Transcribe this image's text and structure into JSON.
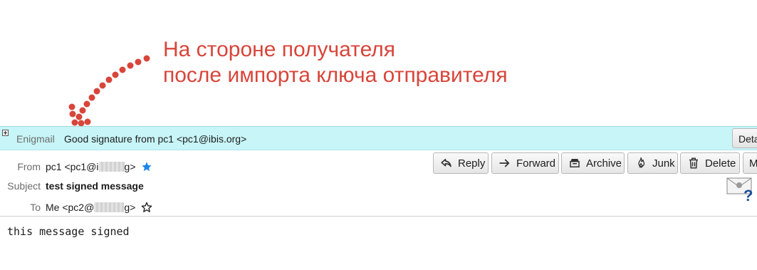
{
  "annotation": {
    "line1": "На стороне получателя",
    "line2": "после импорта ключа отправителя",
    "color": "#d8453a"
  },
  "enigmail": {
    "label": "Enigmail",
    "status": "Good signature from pc1 <pc1@ibis.org>",
    "details_label": "Details",
    "bar_color": "#c8f5f7"
  },
  "header": {
    "from": {
      "label": "From",
      "value_prefix": "pc1 <pc1@i",
      "value_suffix": "g>"
    },
    "subject": {
      "label": "Subject",
      "value": "test signed message"
    },
    "to": {
      "label": "To",
      "value_prefix": "Me <pc2@",
      "value_suffix": "g>"
    }
  },
  "toolbar": {
    "reply": "Reply",
    "forward": "Forward",
    "archive": "Archive",
    "junk": "Junk",
    "delete": "Delete",
    "more": "More"
  },
  "body": {
    "text": "this message signed"
  },
  "icons": {
    "from_star": "star-filled-icon",
    "to_star": "star-outline-icon",
    "sender_status": "unknown-sender-envelope-icon"
  }
}
